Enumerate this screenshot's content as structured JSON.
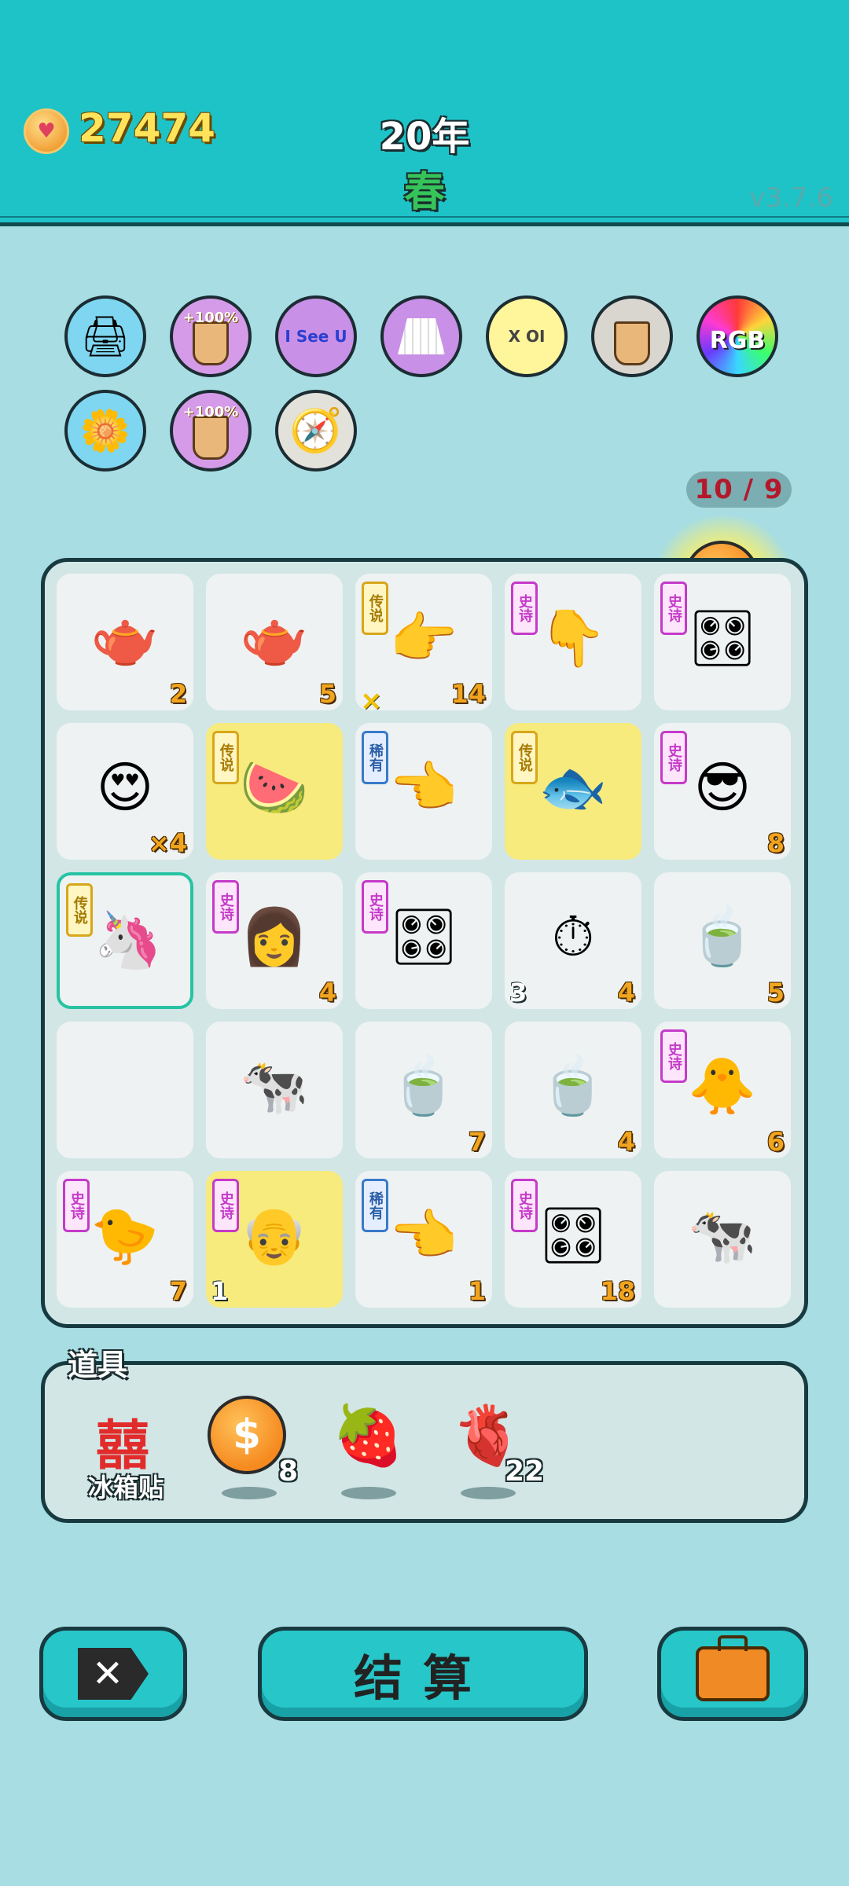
{
  "header": {
    "coins": "27474",
    "year": "20年",
    "season": "春",
    "version": "v3.7.6"
  },
  "buffs": [
    {
      "name": "printer-warning-icon",
      "color": "#7fd6f0",
      "label": ""
    },
    {
      "name": "milk-tea-boost-icon",
      "color": "#d59be8",
      "label": "+100%"
    },
    {
      "name": "i-see-u-icon",
      "color": "#c890e6",
      "label": "I See U"
    },
    {
      "name": "pleated-skirt-icon",
      "color": "#c890e6",
      "label": ""
    },
    {
      "name": "chip-icon",
      "color": "#fff59a",
      "label": "X OI"
    },
    {
      "name": "mushroom-cup-icon",
      "color": "#d8d6cf",
      "label": ""
    },
    {
      "name": "rgb-icon",
      "color": "#ff5a8a",
      "label": "RGB"
    },
    {
      "name": "potted-flower-icon",
      "color": "#7fd6f0",
      "label": ""
    },
    {
      "name": "milk-tea-boost-icon",
      "color": "#d59be8",
      "label": "+100%"
    },
    {
      "name": "compass-icon",
      "color": "#e3e2da",
      "label": ""
    }
  ],
  "counter": "10 / 9",
  "rarity": {
    "legend": "传说",
    "epic": "史诗",
    "rare": "稀有"
  },
  "grid": [
    [
      {
        "icon": "tea-bag-icon",
        "glyph": "🫖",
        "count": "2"
      },
      {
        "icon": "tea-bag-icon",
        "glyph": "🫖",
        "count": "5"
      },
      {
        "icon": "pointing-hand-icon",
        "glyph": "👉",
        "count": "14",
        "badge": "legend",
        "bottomNote": "×"
      },
      {
        "icon": "fading-hand-icon",
        "glyph": "👇",
        "count": "",
        "badge": "epic"
      },
      {
        "icon": "rgb-graphics-card-icon",
        "glyph": "🎛",
        "count": "",
        "badge": "epic"
      }
    ],
    [
      {
        "icon": "heart-eyes-man-icon",
        "glyph": "😍",
        "count": "×4"
      },
      {
        "icon": "watermelon-icon",
        "glyph": "🍉",
        "count": "",
        "badge": "legend",
        "gold": true
      },
      {
        "icon": "brown-hand-icon",
        "glyph": "👈",
        "count": "",
        "badge": "rare"
      },
      {
        "icon": "koi-fish-icon",
        "glyph": "🐟",
        "count": "",
        "badge": "legend",
        "gold": true
      },
      {
        "icon": "sunglasses-man-icon",
        "glyph": "😎",
        "count": "8",
        "badge": "epic"
      }
    ],
    [
      {
        "icon": "unicorn-icon",
        "glyph": "🦄",
        "count": "",
        "badge": "legend",
        "selected": true
      },
      {
        "icon": "girl-hearts-icon",
        "glyph": "👩",
        "count": "4",
        "badge": "epic"
      },
      {
        "icon": "graphics-card-icon",
        "glyph": "🎛",
        "count": "",
        "badge": "epic"
      },
      {
        "icon": "stopwatch-card-icon",
        "glyph": "⏱",
        "count": "4",
        "countLeft": "3"
      },
      {
        "icon": "tea-bowl-icon",
        "glyph": "🍵",
        "count": "5"
      }
    ],
    [
      {
        "icon": "empty-cell",
        "glyph": "",
        "count": ""
      },
      {
        "icon": "cow-fortune-icon",
        "glyph": "🐄",
        "count": ""
      },
      {
        "icon": "tea-bowl-icon",
        "glyph": "🍵",
        "count": "7"
      },
      {
        "icon": "tea-bowl-icon",
        "glyph": "🍵",
        "count": "4"
      },
      {
        "icon": "yellow-chick-icon",
        "glyph": "🐥",
        "count": "6",
        "badge": "epic"
      }
    ],
    [
      {
        "icon": "chick-sparkle-icon",
        "glyph": "🐤",
        "count": "7",
        "badge": "epic"
      },
      {
        "icon": "old-man-icon",
        "glyph": "👴",
        "count": "",
        "countLeft": "1",
        "badge": "epic",
        "gold": true
      },
      {
        "icon": "brown-hand-icon",
        "glyph": "👈",
        "count": "1",
        "badge": "rare"
      },
      {
        "icon": "graphics-card-star-icon",
        "glyph": "🎛",
        "count": "18",
        "badge": "epic"
      },
      {
        "icon": "cow-icon",
        "glyph": "🐄",
        "count": ""
      }
    ]
  ],
  "props": {
    "title": "道具",
    "items": [
      {
        "name": "fridge-sticker-icon",
        "label": "冰箱贴",
        "glyph": "囍",
        "count": ""
      },
      {
        "name": "coin-icon",
        "label": "",
        "glyph": "$",
        "count": "8"
      },
      {
        "name": "strawberry-icon",
        "label": "",
        "glyph": "🍓",
        "count": ""
      },
      {
        "name": "liver-icon",
        "label": "",
        "glyph": "🫀",
        "count": "22"
      }
    ]
  },
  "buttons": {
    "close": "✕",
    "settle": "结算",
    "bag": ""
  }
}
